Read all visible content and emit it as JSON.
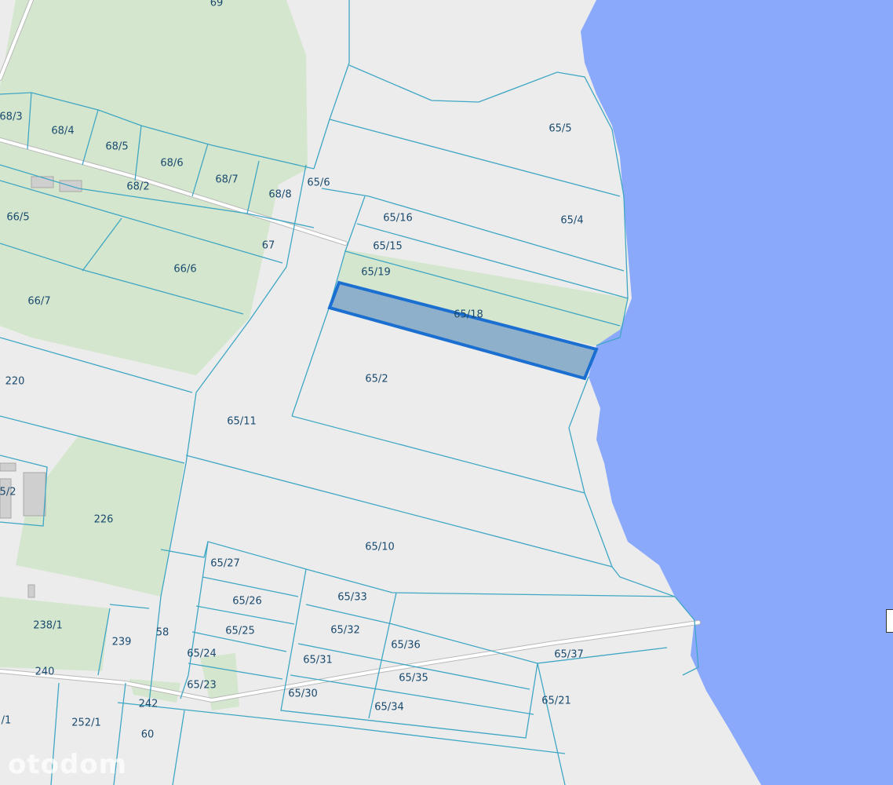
{
  "map": {
    "colors": {
      "background": "#ececec",
      "water": "#8aa9fb",
      "green_area": "#d4e6cd",
      "parcel_line": "#3fa7c4",
      "selected_fill": "#7fa6c4",
      "selected_stroke": "#1a6fd1",
      "label": "#1a4a6e"
    },
    "selected_parcel": "65/18",
    "parcels": {
      "p69": "69",
      "p68_3": "68/3",
      "p68_4": "68/4",
      "p68_5": "68/5",
      "p68_6": "68/6",
      "p68_7": "68/7",
      "p68_8": "68/8",
      "p68_2": "68/2",
      "p65_6": "65/6",
      "p65_5": "65/5",
      "p65_16": "65/16",
      "p65_4": "65/4",
      "p66_5": "66/5",
      "p67": "67",
      "p65_15": "65/15",
      "p66_6": "66/6",
      "p65_19": "65/19",
      "p66_7": "66/7",
      "p65_18": "65/18",
      "p220": "220",
      "p65_2": "65/2",
      "p65_11": "65/11",
      "p5_2": "5/2",
      "p226": "226",
      "p65_10": "65/10",
      "p65_27": "65/27",
      "p65_26": "65/26",
      "p65_33": "65/33",
      "p238_1": "238/1",
      "p58": "58",
      "p65_25": "65/25",
      "p65_32": "65/32",
      "p239": "239",
      "p65_36": "65/36",
      "p65_37": "65/37",
      "p65_24": "65/24",
      "p65_31": "65/31",
      "p240": "240",
      "p65_35": "65/35",
      "p65_23": "65/23",
      "p65_30": "65/30",
      "p65_21": "65/21",
      "p242": "242",
      "p65_34": "65/34",
      "p1": "/1",
      "p252_1": "252/1",
      "p60": "60"
    },
    "watermark": "otodom"
  }
}
